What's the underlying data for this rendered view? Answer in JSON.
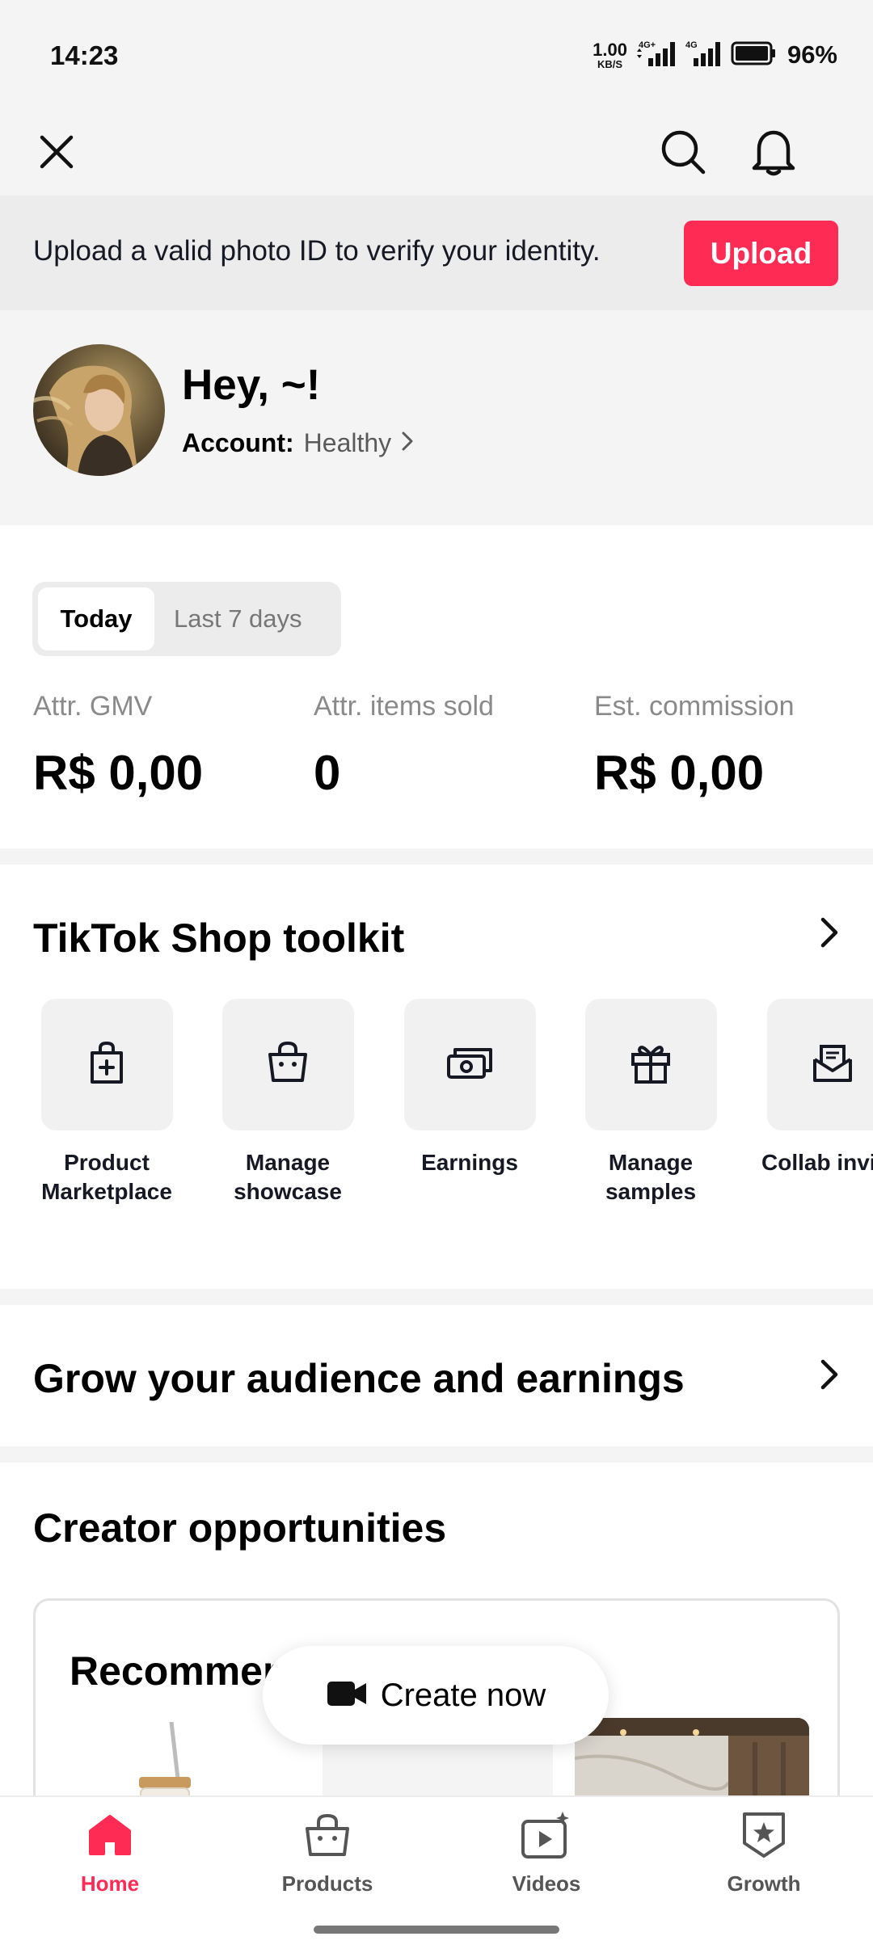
{
  "status_bar": {
    "time": "14:23",
    "net_speed": "1.00",
    "net_speed_unit": "KB/S",
    "battery_percent": "96%"
  },
  "banner": {
    "text": "Upload a valid photo ID to verify your identity.",
    "button_label": "Upload"
  },
  "profile": {
    "greeting": "Hey, ~!",
    "account_label": "Account:",
    "account_status": "Healthy"
  },
  "stats": {
    "tabs": [
      "Today",
      "Last 7 days"
    ],
    "selected_tab": "Today",
    "metrics": [
      {
        "label": "Attr. GMV",
        "value": "R$ 0,00"
      },
      {
        "label": "Attr. items sold",
        "value": "0"
      },
      {
        "label": "Est. commission",
        "value": "R$ 0,00"
      }
    ]
  },
  "toolkit": {
    "title": "TikTok Shop toolkit",
    "items": [
      {
        "label": "Product\nMarketplace",
        "icon": "shopping-bag-plus-icon"
      },
      {
        "label": "Manage\nshowcase",
        "icon": "shop-bag-icon"
      },
      {
        "label": "Earnings",
        "icon": "money-icon"
      },
      {
        "label": "Manage\nsamples",
        "icon": "gift-icon"
      },
      {
        "label": "Collab invit",
        "icon": "mail-icon",
        "has_notification_dot": true
      }
    ]
  },
  "grow": {
    "title": "Grow your audience and earnings"
  },
  "opportunities": {
    "title": "Creator opportunities",
    "card_title": "Recommen"
  },
  "create_button": {
    "label": "Create now"
  },
  "tabbar": {
    "items": [
      {
        "label": "Home",
        "icon": "home-icon",
        "active": true
      },
      {
        "label": "Products",
        "icon": "shopping-bag-icon",
        "active": false
      },
      {
        "label": "Videos",
        "icon": "video-sparkle-icon",
        "active": false
      },
      {
        "label": "Growth",
        "icon": "star-shield-icon",
        "active": false
      }
    ]
  },
  "colors": {
    "accent": "#fe2c55",
    "background_gray": "#f4f4f4"
  }
}
